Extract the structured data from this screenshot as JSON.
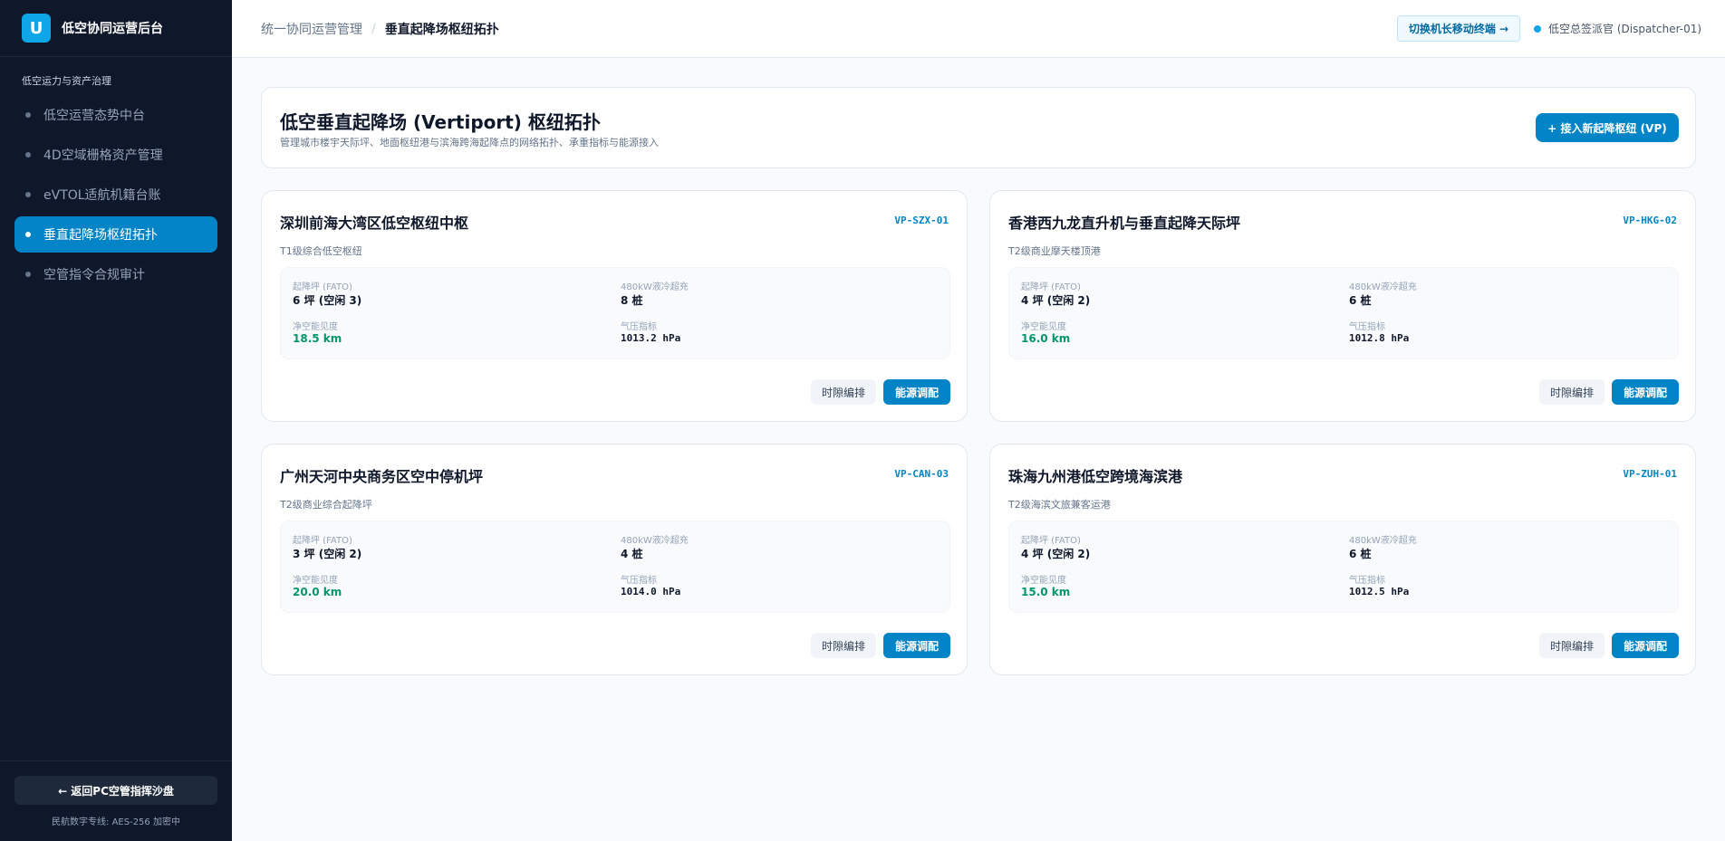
{
  "brand": {
    "logo_letter": "U",
    "name": "低空协同运营后台"
  },
  "sidebar": {
    "section_title": "低空运力与资产治理",
    "items": [
      {
        "label": "低空运营态势中台",
        "active": false
      },
      {
        "label": "4D空域栅格资产管理",
        "active": false
      },
      {
        "label": "eVTOL适航机籍台账",
        "active": false
      },
      {
        "label": "垂直起降场枢纽拓扑",
        "active": true
      },
      {
        "label": "空管指令合规审计",
        "active": false
      }
    ],
    "back_button": "← 返回PC空管指挥沙盘",
    "footer_text": "民航数字专线: AES-256 加密中"
  },
  "topbar": {
    "breadcrumb_parent": "统一协同运营管理",
    "breadcrumb_sep": "/",
    "breadcrumb_current": "垂直起降场枢纽拓扑",
    "switch_button": "切换机长移动终端 →",
    "user": "低空总签派官 (Dispatcher-01)"
  },
  "page": {
    "title": "低空垂直起降场 (Vertiport) 枢纽拓扑",
    "subtitle": "管理城市楼宇天际坪、地面枢纽港与滨海跨海起降点的网络拓扑、承重指标与能源接入",
    "add_button": "+ 接入新起降枢纽 (VP)"
  },
  "labels": {
    "fato": "起降坪 (FATO)",
    "charging": "480kW液冷超充",
    "visibility": "净空能见度",
    "pressure": "气压指标",
    "slot_button": "时隙编排",
    "energy_button": "能源调配"
  },
  "vertiports": [
    {
      "name": "深圳前海大湾区低空枢纽中枢",
      "code": "VP-SZX-01",
      "tier": "T1级综合低空枢纽",
      "fato": "6 坪 (空闲 3)",
      "charging": "8 桩",
      "visibility": "18.5 km",
      "pressure": "1013.2 hPa"
    },
    {
      "name": "香港西九龙直升机与垂直起降天际坪",
      "code": "VP-HKG-02",
      "tier": "T2级商业摩天楼顶港",
      "fato": "4 坪 (空闲 2)",
      "charging": "6 桩",
      "visibility": "16.0 km",
      "pressure": "1012.8 hPa"
    },
    {
      "name": "广州天河中央商务区空中停机坪",
      "code": "VP-CAN-03",
      "tier": "T2级商业综合起降坪",
      "fato": "3 坪 (空闲 2)",
      "charging": "4 桩",
      "visibility": "20.0 km",
      "pressure": "1014.0 hPa"
    },
    {
      "name": "珠海九州港低空跨境海滨港",
      "code": "VP-ZUH-01",
      "tier": "T2级海滨文旅兼客运港",
      "fato": "4 坪 (空闲 2)",
      "charging": "6 桩",
      "visibility": "15.0 km",
      "pressure": "1012.5 hPa"
    }
  ]
}
